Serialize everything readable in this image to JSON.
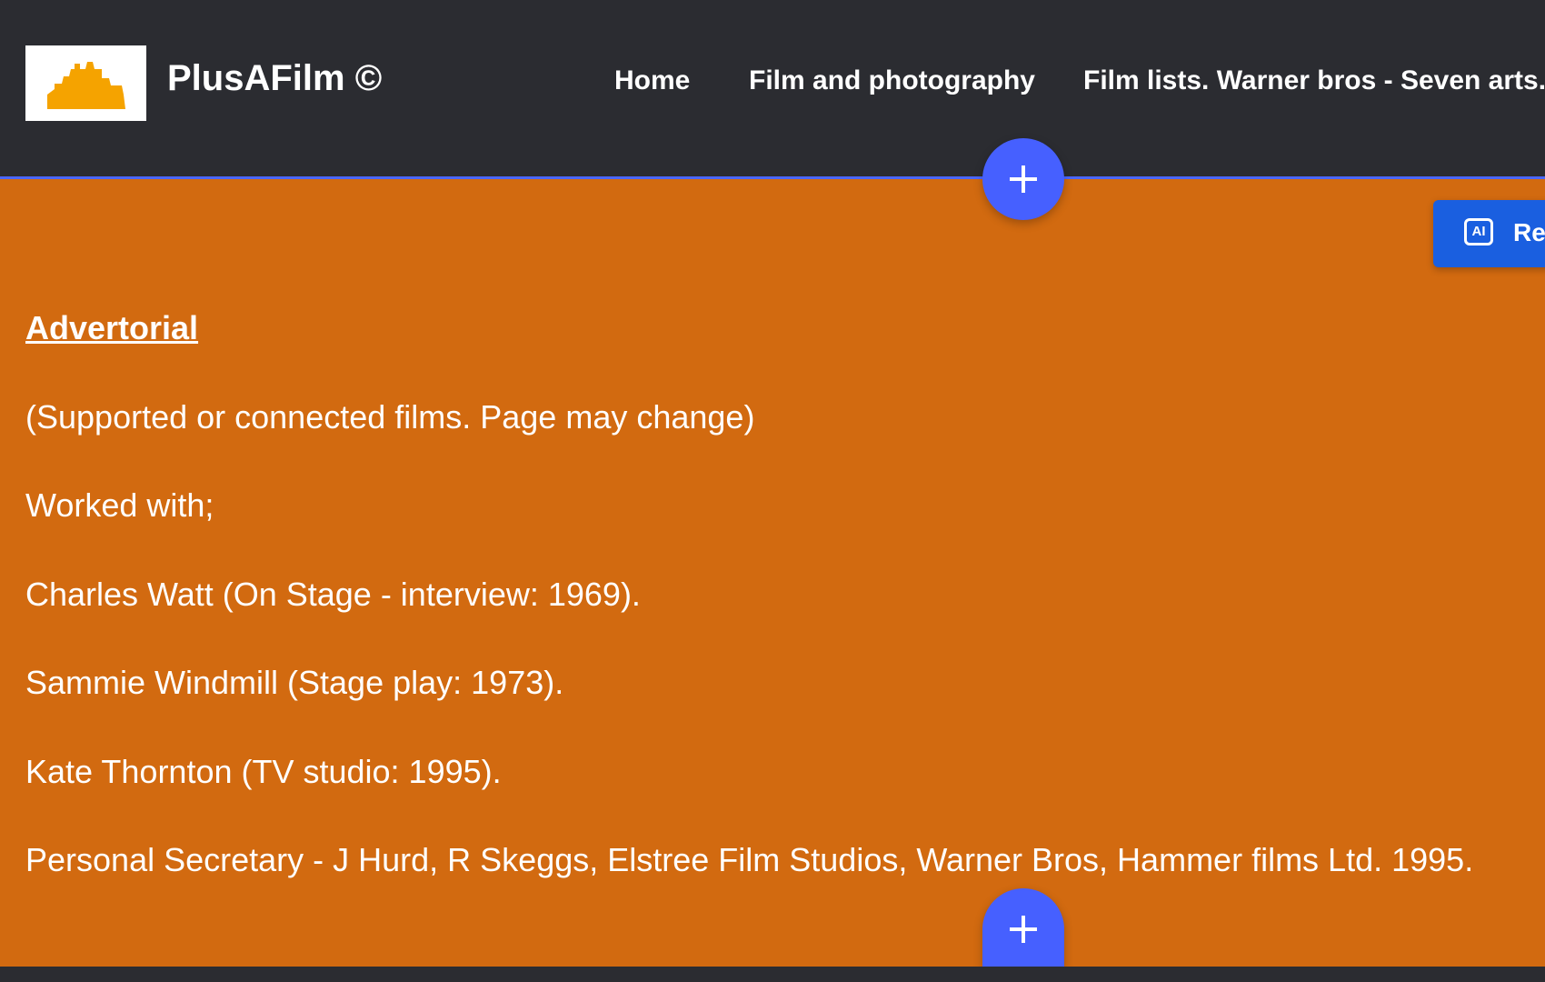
{
  "header": {
    "site_title": "PlusAFilm ©",
    "nav": {
      "home": "Home",
      "film": "Film and photography",
      "lists": "Film lists. Warner bros - Seven arts."
    }
  },
  "editor": {
    "add_icon": "plus-icon",
    "ai_badge": {
      "icon_label": "AI",
      "text": "Re"
    }
  },
  "content": {
    "heading": "Advertorial ",
    "subtitle": "(Supported or connected films. Page may change)",
    "worked_with": "Worked with;",
    "entries": [
      "Charles Watt  (On Stage - interview: 1969).",
      "Sammie Windmill  (Stage play: 1973).",
      "Kate Thornton  (TV studio: 1995).",
      "Personal Secretary - J Hurd, R Skeggs, Elstree Film Studios, Warner Bros, Hammer films Ltd. 1995."
    ]
  },
  "colors": {
    "header_bg": "#2b2c31",
    "section_bg": "#d26a10",
    "accent_blue": "#4660ff",
    "logo_orange": "#f5a300"
  }
}
